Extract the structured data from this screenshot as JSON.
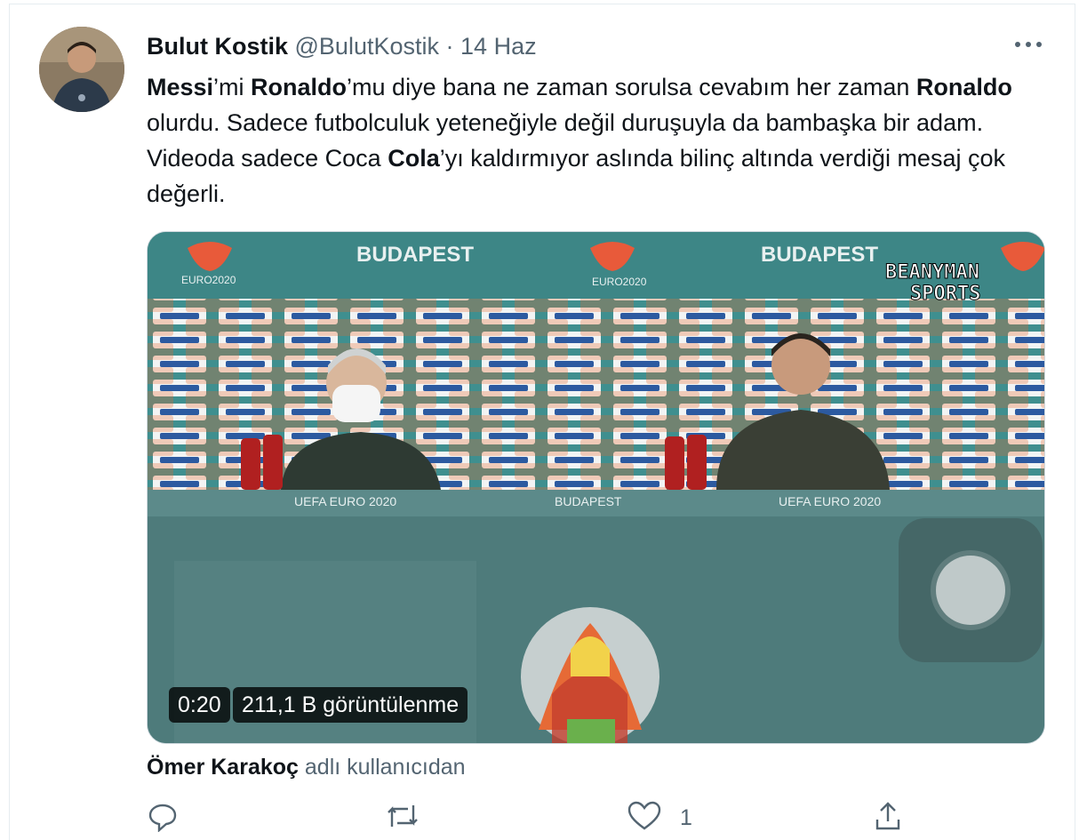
{
  "tweet": {
    "author_name": "Bulut Kostik",
    "handle": "@BulutKostik",
    "separator": "·",
    "date": "14 Haz",
    "text_segments": [
      {
        "t": "Messi",
        "b": true
      },
      {
        "t": "’mi ",
        "b": false
      },
      {
        "t": "Ronaldo",
        "b": true
      },
      {
        "t": "’mu diye bana ne zaman sorulsa cevabım her zaman ",
        "b": false
      },
      {
        "t": "Ronaldo",
        "b": true
      },
      {
        "t": " olurdu. Sadece futbolculuk yeteneğiyle değil duruşuyla da bambaşka bir adam. Videoda sadece Coca ",
        "b": false
      },
      {
        "t": "Cola",
        "b": true
      },
      {
        "t": "’yı kaldırmıyor aslında bilinç altında verdiği mesaj çok değerli.",
        "b": false
      }
    ]
  },
  "media": {
    "duration": "0:20",
    "views": "211,1 B görüntülenme",
    "banner_city": "BUDAPEST",
    "banner_logo": "EURO2020",
    "desk_left": "UEFA EURO 2020",
    "desk_center": "BUDAPEST",
    "desk_right": "UEFA EURO 2020",
    "watermark_line1": "BEANYMAN",
    "watermark_line2": "SPORTS"
  },
  "attribution": {
    "user": "Ömer Karakoç",
    "suffix": "adlı kullanıcıdan"
  },
  "actions": {
    "like_count": "1",
    "icons": [
      "reply-icon",
      "retweet-icon",
      "like-icon",
      "share-icon"
    ]
  },
  "colors": {
    "muted": "#536471",
    "border": "#e6ecf0",
    "backdrop": "#4a7a7a",
    "desk": "#4e7b7b"
  }
}
